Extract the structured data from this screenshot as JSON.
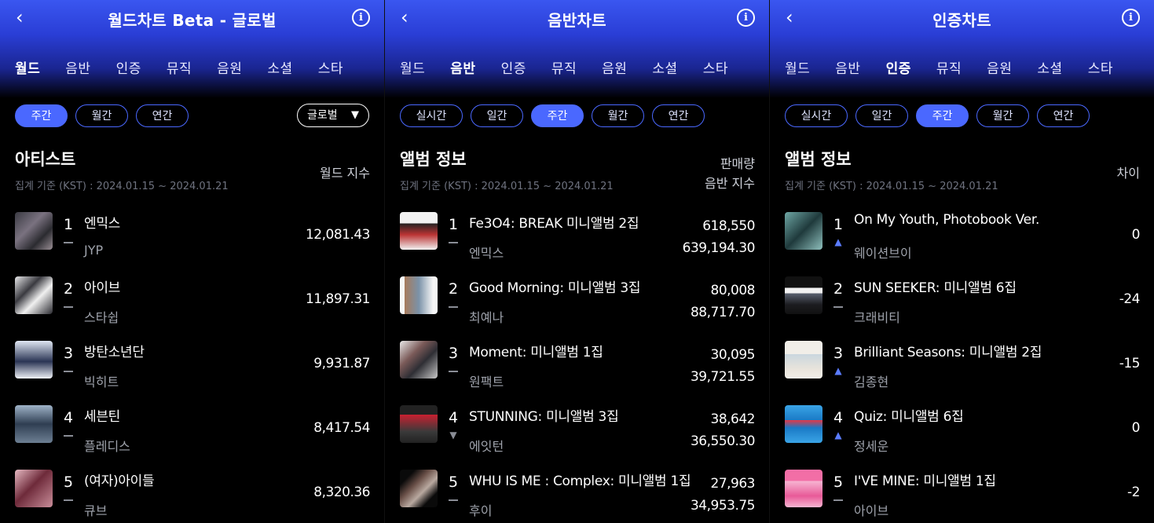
{
  "panels": [
    {
      "title": "월드차트 Beta - 글로벌",
      "tabs": [
        "월드",
        "음반",
        "인증",
        "뮤직",
        "음원",
        "소셜",
        "스타"
      ],
      "active_tab": 0,
      "pills": [
        "주간",
        "월간",
        "연간"
      ],
      "active_pill": 0,
      "dropdown": "글로벌",
      "section_title": "아티스트",
      "date": "집계 기준 (KST) : 2024.01.15 ~ 2024.01.21",
      "col_header": [
        "월드 지수"
      ],
      "rows": [
        {
          "rank": "1",
          "change": "same",
          "name": "엔믹스",
          "sub": "JYP",
          "values": [
            "12,081.43"
          ]
        },
        {
          "rank": "2",
          "change": "same",
          "name": "아이브",
          "sub": "스타쉽",
          "values": [
            "11,897.31"
          ]
        },
        {
          "rank": "3",
          "change": "same",
          "name": "방탄소년단",
          "sub": "빅히트",
          "values": [
            "9,931.87"
          ]
        },
        {
          "rank": "4",
          "change": "same",
          "name": "세븐틴",
          "sub": "플레디스",
          "values": [
            "8,417.54"
          ]
        },
        {
          "rank": "5",
          "change": "same",
          "name": "(여자)아이들",
          "sub": "큐브",
          "values": [
            "8,320.36"
          ]
        }
      ]
    },
    {
      "title": "음반차트",
      "tabs": [
        "월드",
        "음반",
        "인증",
        "뮤직",
        "음원",
        "소셜",
        "스타"
      ],
      "active_tab": 1,
      "pills": [
        "실시간",
        "일간",
        "주간",
        "월간",
        "연간"
      ],
      "active_pill": 2,
      "section_title": "앨범 정보",
      "date": "집계 기준 (KST) : 2024.01.15 ~ 2024.01.21",
      "col_header": [
        "판매량",
        "음반 지수"
      ],
      "rows": [
        {
          "rank": "1",
          "change": "same",
          "name": "Fe3O4: BREAK 미니앨범 2집",
          "sub": "엔믹스",
          "values": [
            "618,550",
            "639,194.30"
          ]
        },
        {
          "rank": "2",
          "change": "same",
          "name": "Good Morning: 미니앨범 3집",
          "sub": "최예나",
          "values": [
            "80,008",
            "88,717.70"
          ]
        },
        {
          "rank": "3",
          "change": "same",
          "name": "Moment: 미니앨범 1집",
          "sub": "원팩트",
          "values": [
            "30,095",
            "39,721.55"
          ]
        },
        {
          "rank": "4",
          "change": "down",
          "name": "STUNNING: 미니앨범 3집",
          "sub": "에잇턴",
          "values": [
            "38,642",
            "36,550.30"
          ]
        },
        {
          "rank": "5",
          "change": "same",
          "name": "WHU IS ME : Complex: 미니앨범 1집",
          "sub": "후이",
          "values": [
            "27,963",
            "34,953.75"
          ]
        }
      ]
    },
    {
      "title": "인증차트",
      "tabs": [
        "월드",
        "음반",
        "인증",
        "뮤직",
        "음원",
        "소셜",
        "스타"
      ],
      "active_tab": 2,
      "pills": [
        "실시간",
        "일간",
        "주간",
        "월간",
        "연간"
      ],
      "active_pill": 2,
      "section_title": "앨범 정보",
      "date": "집계 기준 (KST) : 2024.01.15 ~ 2024.01.21",
      "col_header": [
        "차이"
      ],
      "rows": [
        {
          "rank": "1",
          "change": "up",
          "name": "On My Youth, Photobook Ver.",
          "sub": "웨이션브이",
          "values": [
            "0"
          ]
        },
        {
          "rank": "2",
          "change": "same",
          "name": "SUN SEEKER: 미니앨범 6집",
          "sub": "크래비티",
          "values": [
            "-24"
          ]
        },
        {
          "rank": "3",
          "change": "up",
          "name": "Brilliant Seasons: 미니앨범 2집",
          "sub": "김종현",
          "values": [
            "-15"
          ]
        },
        {
          "rank": "4",
          "change": "up",
          "name": "Quiz: 미니앨범 6집",
          "sub": "정세운",
          "values": [
            "0"
          ]
        },
        {
          "rank": "5",
          "change": "same",
          "name": "I'VE MINE: 미니앨범 1집",
          "sub": "아이브",
          "values": [
            "-2"
          ]
        }
      ]
    }
  ],
  "icons": {
    "back": "chevron-left-icon",
    "info": "info-icon",
    "dropdown": "triangle-down-icon"
  },
  "colors": {
    "accent": "#4a68ff",
    "header_gradient_top": "#3a56f0",
    "background": "#000000",
    "up": "#5b7cff"
  }
}
